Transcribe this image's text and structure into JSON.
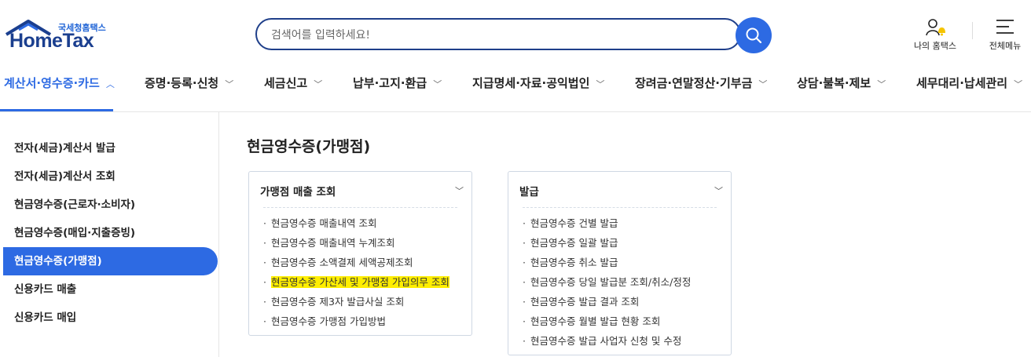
{
  "header": {
    "logo_kr": "국세청홈택스",
    "logo_en": "HomeTax",
    "search_placeholder": "검색어를 입력하세요!",
    "my_hometax_label": "나의 홈택스",
    "all_menu_label": "전체메뉴"
  },
  "gnb": {
    "items": [
      {
        "label": "계산서·영수증·카드",
        "active": true
      },
      {
        "label": "증명·등록·신청"
      },
      {
        "label": "세금신고"
      },
      {
        "label": "납부·고지·환급"
      },
      {
        "label": "지급명세·자료·공익법인"
      },
      {
        "label": "장려금·연말정산·기부금"
      },
      {
        "label": "상담·불복·제보"
      },
      {
        "label": "세무대리·납세관리"
      }
    ]
  },
  "lnb": {
    "items": [
      {
        "label": "전자(세금)계산서 발급"
      },
      {
        "label": "전자(세금)계산서 조회"
      },
      {
        "label": "현금영수증(근로자·소비자)"
      },
      {
        "label": "현금영수증(매입·지출증빙)"
      },
      {
        "label": "현금영수증(가맹점)",
        "active": true
      },
      {
        "label": "신용카드 매출"
      },
      {
        "label": "신용카드 매입"
      }
    ]
  },
  "main": {
    "title": "현금영수증(가맹점)",
    "cards": [
      {
        "heading": "가맹점 매출 조회",
        "items": [
          {
            "label": "현금영수증 매출내역 조회"
          },
          {
            "label": "현금영수증 매출내역 누계조회"
          },
          {
            "label": "현금영수증 소액결제 세액공제조회"
          },
          {
            "label": "현금영수증 가산세 및 가맹점 가입의무 조회",
            "highlight": true
          },
          {
            "label": "현금영수증 제3자 발급사실 조회"
          },
          {
            "label": "현금영수증 가맹점 가입방법"
          }
        ]
      },
      {
        "heading": "발급",
        "items": [
          {
            "label": "현금영수증 건별 발급"
          },
          {
            "label": "현금영수증 일괄 발급"
          },
          {
            "label": "현금영수증 취소 발급"
          },
          {
            "label": "현금영수증 당일 발급분 조회/취소/정정"
          },
          {
            "label": "현금영수증 발급 결과 조회"
          },
          {
            "label": "현금영수증 월별 발급 현황 조회"
          },
          {
            "label": "현금영수증 발급 사업자 신청 및 수정"
          }
        ]
      }
    ]
  },
  "colors": {
    "accent": "#2d6ae3",
    "logo_navy": "#1b3f8f",
    "highlight": "#ffee00",
    "bell": "#f5c400"
  },
  "icons": {
    "search": "search-icon",
    "my_hometax": "user-bell-icon",
    "all_menu": "hamburger-icon",
    "gnb_chevron": "chevron-down-icon",
    "gnb_chevron_active": "chevron-up-icon",
    "card_chevron": "chevron-down-icon"
  }
}
